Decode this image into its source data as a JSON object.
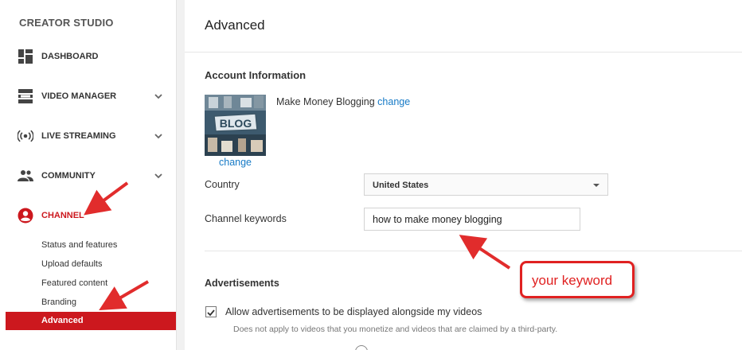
{
  "sidebar": {
    "title": "CREATOR STUDIO",
    "items": [
      {
        "label": "DASHBOARD",
        "icon": "dashboard-icon",
        "has_chevron": false
      },
      {
        "label": "VIDEO MANAGER",
        "icon": "video-manager-icon",
        "has_chevron": true
      },
      {
        "label": "LIVE STREAMING",
        "icon": "live-streaming-icon",
        "has_chevron": true
      },
      {
        "label": "COMMUNITY",
        "icon": "community-icon",
        "has_chevron": true
      },
      {
        "label": "CHANNEL",
        "icon": "channel-icon",
        "active": true
      }
    ],
    "channel_subitems": [
      "Status and features",
      "Upload defaults",
      "Featured content",
      "Branding",
      "Advanced"
    ],
    "active_subitem": "Advanced"
  },
  "main": {
    "title": "Advanced",
    "account_section": {
      "title": "Account Information",
      "channel_name": "Make Money Blogging",
      "change_link": "change",
      "thumbnail_change_link": "change",
      "thumbnail_text": "BLOG",
      "country_label": "Country",
      "country_value": "United States",
      "keywords_label": "Channel keywords",
      "keywords_value": "how to make money blogging"
    },
    "ads_section": {
      "title": "Advertisements",
      "checkbox_label": "Allow advertisements to be displayed alongside my videos",
      "checkbox_checked": true,
      "note": "Does not apply to videos that you monetize and videos that are claimed by a third-party."
    }
  },
  "annotation": {
    "callout_text": "your keyword"
  },
  "colors": {
    "accent_red": "#cc181e",
    "link_blue": "#167ac6",
    "annotation_red": "#e02121"
  }
}
